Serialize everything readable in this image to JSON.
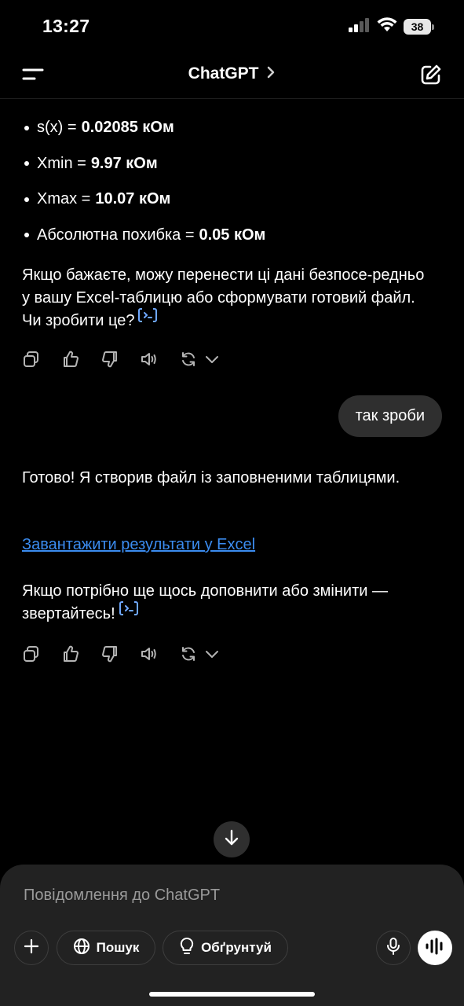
{
  "status_bar": {
    "time": "13:27",
    "battery": "38"
  },
  "header": {
    "title": "ChatGPT"
  },
  "bullets": [
    {
      "label": "s(x) =",
      "value": "0.02085 кОм"
    },
    {
      "label": "Xmin =",
      "value": "9.97 кОм"
    },
    {
      "label": "Xmax =",
      "value": "10.07 кОм"
    },
    {
      "label": "Абсолютна похибка =",
      "value": "0.05 кОм"
    }
  ],
  "assistant_msg_1": {
    "text": "Якщо бажаєте, можу перенести ці дані безпосе-редньо у вашу Excel-таблицю або сформувати готовий файл. Чи зробити це?"
  },
  "user_msg": {
    "text": "так зроби"
  },
  "assistant_msg_2": {
    "intro": "Готово! Я створив файл із заповненими таблицями.",
    "link": "Завантажити результати у Excel",
    "outro": "Якщо потрібно ще щось доповнити або змінити — звертайтесь!"
  },
  "composer": {
    "placeholder": "Повідомлення до ChatGPT",
    "search_label": "Пошук",
    "reason_label": "Обґрунтуй"
  },
  "icons": {
    "menu": "menu-icon",
    "new_chat": "new-chat-icon",
    "copy": "copy-icon",
    "like": "thumbs-up-icon",
    "dislike": "thumbs-down-icon",
    "read_aloud": "speaker-icon",
    "regenerate": "refresh-icon",
    "scroll_down": "arrow-down-icon",
    "plus": "plus-icon",
    "globe": "globe-icon",
    "bulb": "lightbulb-icon",
    "mic": "microphone-icon",
    "voice": "voice-wave-icon"
  },
  "colors": {
    "background": "#000000",
    "link": "#3b8cf0",
    "bubble": "#2f2f2f",
    "composer": "#222222"
  }
}
